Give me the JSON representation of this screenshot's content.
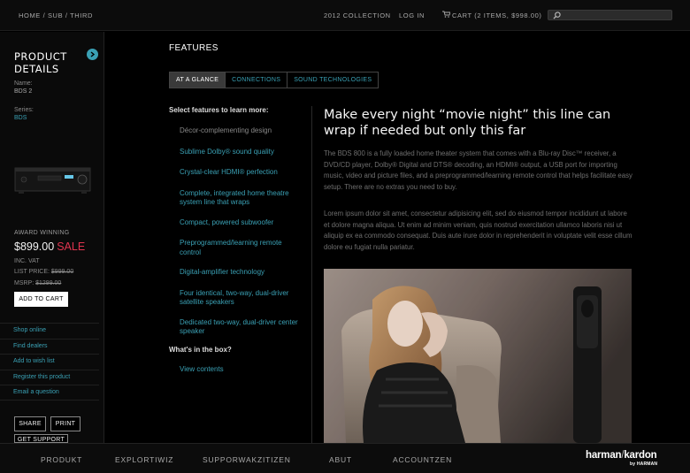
{
  "topbar": {
    "breadcrumb": "HOME / SUB / THIRD",
    "collection": "2012 COLLECTION",
    "login": "LOG IN",
    "cart": "CART (2 ITEMS, $998.00)",
    "search_placeholder": ""
  },
  "sidebar": {
    "title_line1": "PRODUCT",
    "title_line2": "DETAILS",
    "name_label": "Name:",
    "name_value": "BDS 2",
    "series_label": "Series:",
    "series_value": "BDS",
    "award": "AWARD WINNING",
    "price": "$899.00",
    "sale": "SALE",
    "vat": "INC. VAT",
    "list_label": "LIST PRICE:",
    "list_price": "$999.00",
    "msrp_label": "MSRP:",
    "msrp_price": "$1299.00",
    "add_to_cart": "ADD TO CART",
    "links": [
      "Shop online",
      "Find dealers",
      "Add to wish list",
      "Register this product",
      "Email a question"
    ],
    "share": "SHARE",
    "print": "PRINT",
    "get_support": "GET SUPPORT"
  },
  "main": {
    "section_title": "FEATURES",
    "tabs": [
      "AT A GLANCE",
      "CONNECTIONS",
      "SOUND TECHNOLOGIES"
    ],
    "select_heading": "Select features to learn more:",
    "features": [
      "Décor-complementing design",
      "Sublime Dolby® sound quality",
      "Crystal-clear HDMI® perfection",
      "Complete, integrated home theatre system line that wraps",
      "Compact, powered subwoofer",
      "Preprogrammed/learning remote control",
      "Digital-amplifier technology",
      "Four identical, two-way, dual-driver satellite speakers",
      "Dedicated two-way, dual-driver center speaker"
    ],
    "whats_in_box": "What's in the box?",
    "view_contents": "View contents",
    "headline": "Make every night “movie night” this line can wrap if needed but only this far",
    "paragraph1": "The BDS 800 is a fully loaded home theater system that comes with a Blu-ray Disc™ receiver, a DVD/CD player, Dolby® Digital and DTS® decoding, an HDMI® output, a USB port for importing music, video and picture files, and a preprogrammed/learning remote control that helps facilitate easy setup. There are no extras you need to buy.",
    "paragraph2": "Lorem ipsum dolor sit amet, consectetur adipisicing elit, sed do eiusmod tempor incididunt ut labore et dolore magna aliqua. Ut enim ad minim veniam, quis nostrud exercitation ullamco laboris nisi ut aliquip ex ea commodo consequat. Duis aute irure dolor in reprehenderit in voluptate velit esse cillum dolore eu fugiat nulla pariatur."
  },
  "footer": {
    "nav": [
      "PRODUKT",
      "EXPLORTIWIZ",
      "SUPPORWAKZITIZEN",
      "ABUT",
      "ACCOUNTZEN"
    ],
    "brand_left": "harman",
    "brand_right": "kardon",
    "brand_sub": "by HARMAN"
  },
  "colors": {
    "accent": "#3aa0b4",
    "sale": "#e0344f",
    "background": "#000000"
  }
}
